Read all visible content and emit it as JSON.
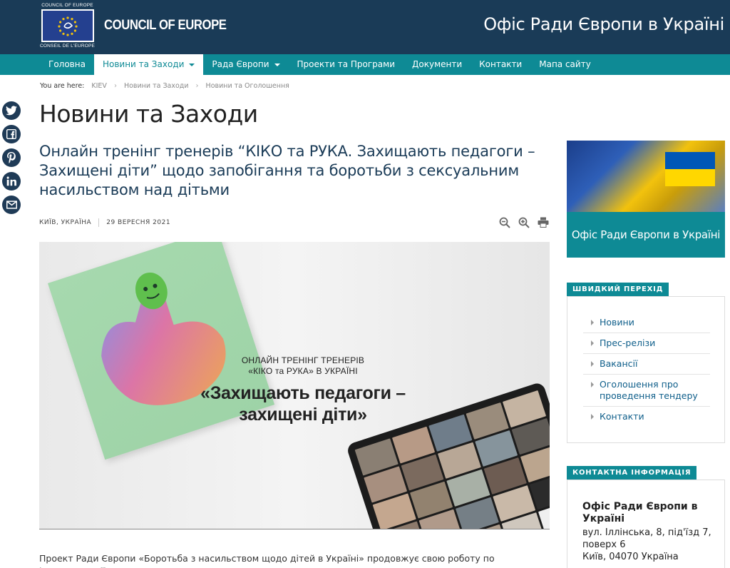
{
  "header": {
    "logo_small_top": "COUNCIL OF EUROPE",
    "logo_small_bottom": "CONSEIL DE L'EUROPE",
    "logo_text": "COUNCIL OF EUROPE",
    "site_title": "Офіс Ради Європи в Україні"
  },
  "nav": {
    "items": [
      {
        "label": "Головна"
      },
      {
        "label": "Новини та Заходи"
      },
      {
        "label": "Рада Європи"
      },
      {
        "label": "Проекти та Програми"
      },
      {
        "label": "Документи"
      },
      {
        "label": "Контакти"
      },
      {
        "label": "Мапа сайту"
      }
    ]
  },
  "breadcrumb": {
    "label": "You are here:",
    "items": [
      "KIEV",
      "Новини та Заходи",
      "Новини та Оголошення"
    ]
  },
  "share": [
    "twitter-icon",
    "facebook-icon",
    "pinterest-icon",
    "linkedin-icon",
    "email-icon"
  ],
  "page": {
    "title": "Новини та Заходи"
  },
  "article": {
    "title": "Онлайн тренінг тренерів “КІКО та РУКА. Захищають педагоги – Захищені діти” щодо запобігання та боротьби з сексуальним насильством над дітьми",
    "location": "КИЇВ, УКРАЇНА",
    "date": "29 ВЕРЕСНЯ 2021",
    "hero_line1": "ОНЛАЙН ТРЕНІНГ ТРЕНЕРІВ",
    "hero_line2": "«КІКО та РУКА» В УКРАЇНІ",
    "hero_heading": "«Захищають педагоги – захищені діти»",
    "body_start": "Проект Ради Європи «Боротьба з насильством щодо дітей в Україні» продовжує свою роботу по імплементації"
  },
  "sidebar": {
    "flag_caption": "Офіс Ради Європи в Україні",
    "quick_title": "ШВИДКИЙ ПЕРЕХІД",
    "quick_links": [
      {
        "label": "Новини"
      },
      {
        "label": "Прес-релізи"
      },
      {
        "label": "Вакансії"
      },
      {
        "label": "Оголошення про проведення тендеру"
      },
      {
        "label": "Контакти"
      }
    ],
    "contact_title": "КОНТАКТНА ІНФОРМАЦІЯ",
    "contact_org": "Офіс Ради Європи в Україні",
    "contact_addr": "вул. Іллінська, 8, під'їзд 7, поверх 6",
    "contact_city": "Київ, 04070 Україна"
  },
  "colors": {
    "header_bg": "#1a3b57",
    "nav_bg": "#0e8a95",
    "accent": "#0e8a95",
    "link": "#0e5e8a"
  }
}
